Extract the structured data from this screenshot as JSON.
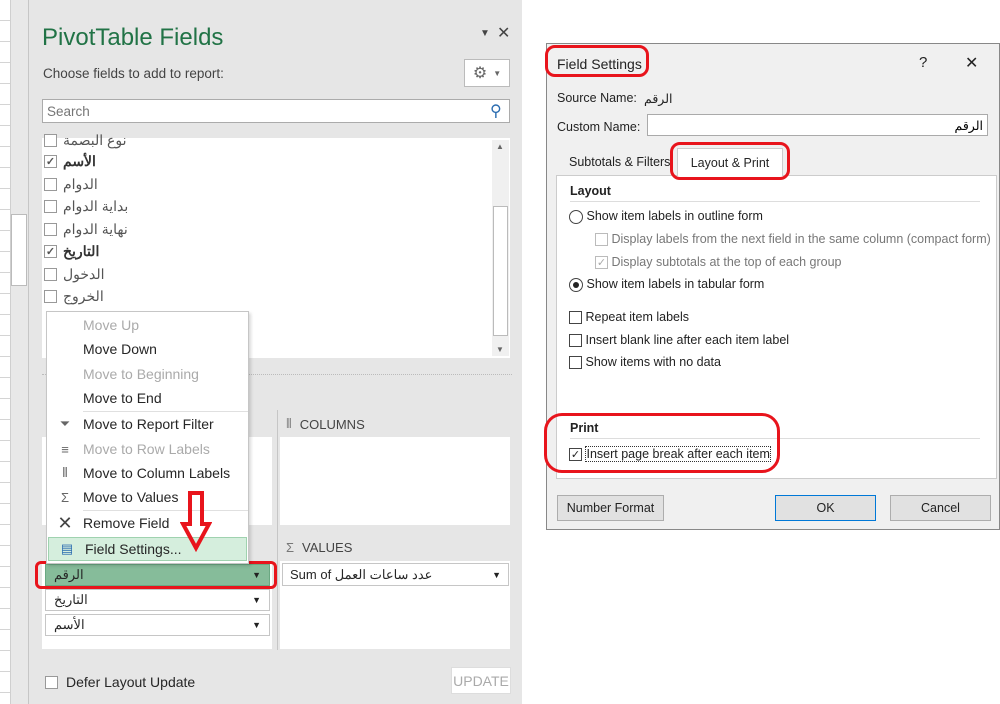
{
  "pane": {
    "title": "PivotTable Fields",
    "subtitle": "Choose fields to add to report:",
    "search_placeholder": "Search",
    "fields": [
      {
        "label": "نوع البصمة",
        "checked": false
      },
      {
        "label": "الأسم",
        "checked": true
      },
      {
        "label": "الدوام",
        "checked": false
      },
      {
        "label": "بداية الدوام",
        "checked": false
      },
      {
        "label": "نهاية الدوام",
        "checked": false
      },
      {
        "label": "التاريخ",
        "checked": true
      },
      {
        "label": "الدخول",
        "checked": false
      },
      {
        "label": "الخروج",
        "checked": false
      }
    ],
    "columns_label": "COLUMNS",
    "values_label": "VALUES",
    "rows": [
      "الرقم",
      "التاريخ",
      "الأسم"
    ],
    "values": [
      "Sum of عدد ساعات العمل"
    ],
    "defer_label": "Defer Layout Update",
    "update_label": "UPDATE"
  },
  "menu": {
    "items": [
      {
        "label": "Move Up",
        "disabled": true,
        "icon": ""
      },
      {
        "label": "Move Down",
        "disabled": false,
        "icon": ""
      },
      {
        "label": "Move to Beginning",
        "disabled": true,
        "icon": ""
      },
      {
        "label": "Move to End",
        "disabled": false,
        "icon": ""
      },
      {
        "label": "Move to Report Filter",
        "disabled": false,
        "icon": "filter-icon"
      },
      {
        "label": "Move to Row Labels",
        "disabled": true,
        "icon": "rows-icon"
      },
      {
        "label": "Move to Column Labels",
        "disabled": false,
        "icon": "columns-icon"
      },
      {
        "label": "Move to Values",
        "disabled": false,
        "icon": "sigma-icon"
      },
      {
        "label": "Remove Field",
        "disabled": false,
        "icon": "x-icon"
      },
      {
        "label": "Field Settings...",
        "disabled": false,
        "icon": "field-settings-icon",
        "highlighted": true
      }
    ]
  },
  "dialog": {
    "title": "Field Settings",
    "help": "?",
    "close": "✕",
    "source_label": "Source Name:",
    "source_value": "الرقم",
    "custom_label": "Custom Name:",
    "custom_value": "الرقم",
    "tabs": [
      {
        "label": "Subtotals & Filters",
        "active": false
      },
      {
        "label": "Layout & Print",
        "active": true
      }
    ],
    "layout_heading": "Layout",
    "outline_label": "Show item labels in outline form",
    "compact_label": "Display labels from the next field in the same column (compact form)",
    "subtotals_top_label": "Display subtotals at the top of each group",
    "tabular_label": "Show item labels in tabular form",
    "repeat_label": "Repeat item labels",
    "blank_line_label": "Insert blank line after each item label",
    "no_data_label": "Show items with no data",
    "print_heading": "Print",
    "page_break_label": "Insert page break after each item",
    "page_break_checked": true,
    "number_format": "Number Format",
    "ok": "OK",
    "cancel": "Cancel"
  },
  "colors": {
    "accent": "#217346",
    "annotation": "#e8141c",
    "selected_field": "#86bc9a",
    "menu_highlight": "#d5eedd"
  }
}
